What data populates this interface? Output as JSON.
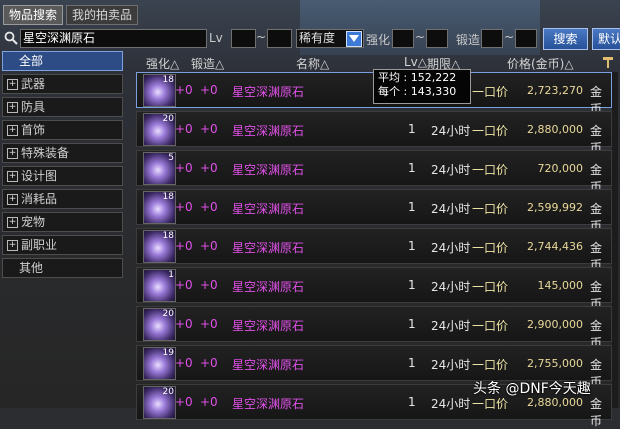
{
  "tabs": [
    {
      "label": "物品搜索",
      "active": true
    },
    {
      "label": "我的拍卖品",
      "active": false
    }
  ],
  "search": {
    "name_value": "星空深渊原石",
    "lv_label": "Lv",
    "tilde": "~",
    "rarity_value": "稀有度",
    "enhance_label": "强化",
    "forge_label": "锻造",
    "search_button": "搜索",
    "default_button": "默认"
  },
  "sidebar": {
    "items": [
      {
        "label": "全部",
        "plus": false,
        "active": true
      },
      {
        "label": "武器",
        "plus": true
      },
      {
        "label": "防具",
        "plus": true
      },
      {
        "label": "首饰",
        "plus": true
      },
      {
        "label": "特殊装备",
        "plus": true
      },
      {
        "label": "设计图",
        "plus": true
      },
      {
        "label": "消耗品",
        "plus": true
      },
      {
        "label": "宠物",
        "plus": true
      },
      {
        "label": "副职业",
        "plus": true
      },
      {
        "label": "其他",
        "plus": false
      }
    ]
  },
  "table": {
    "headers": {
      "enhance": "强化△",
      "forge": "锻造△",
      "name": "名称△",
      "lv": "Lv△",
      "period": "期限△",
      "price": "价格(金币)△"
    },
    "rows": [
      {
        "count": "18",
        "enh": "+0",
        "forge": "+0",
        "name": "星空深渊原石",
        "qty": "",
        "period": "",
        "type": "一口价",
        "price": "2,723,270",
        "unit": "金币",
        "selected": true
      },
      {
        "count": "20",
        "enh": "+0",
        "forge": "+0",
        "name": "星空深渊原石",
        "qty": "1",
        "period": "24小时",
        "type": "一口价",
        "price": "2,880,000",
        "unit": "金币"
      },
      {
        "count": "5",
        "enh": "+0",
        "forge": "+0",
        "name": "星空深渊原石",
        "qty": "1",
        "period": "24小时",
        "type": "一口价",
        "price": "720,000",
        "unit": "金币"
      },
      {
        "count": "18",
        "enh": "+0",
        "forge": "+0",
        "name": "星空深渊原石",
        "qty": "1",
        "period": "24小时",
        "type": "一口价",
        "price": "2,599,992",
        "unit": "金币"
      },
      {
        "count": "18",
        "enh": "+0",
        "forge": "+0",
        "name": "星空深渊原石",
        "qty": "1",
        "period": "24小时",
        "type": "一口价",
        "price": "2,744,436",
        "unit": "金币"
      },
      {
        "count": "1",
        "enh": "+0",
        "forge": "+0",
        "name": "星空深渊原石",
        "qty": "1",
        "period": "24小时",
        "type": "一口价",
        "price": "145,000",
        "unit": "金币"
      },
      {
        "count": "20",
        "enh": "+0",
        "forge": "+0",
        "name": "星空深渊原石",
        "qty": "1",
        "period": "24小时",
        "type": "一口价",
        "price": "2,900,000",
        "unit": "金币"
      },
      {
        "count": "19",
        "enh": "+0",
        "forge": "+0",
        "name": "星空深渊原石",
        "qty": "1",
        "period": "24小时",
        "type": "一口价",
        "price": "2,755,000",
        "unit": "金币"
      },
      {
        "count": "20",
        "enh": "+0",
        "forge": "+0",
        "name": "星空深渊原石",
        "qty": "1",
        "period": "24小时",
        "type": "一口价",
        "price": "2,880,000",
        "unit": "金币"
      }
    ]
  },
  "tooltip": {
    "avg": "平均 : 152,222",
    "each": "每个 : 143,330"
  },
  "watermark": "头条 @DNF今天趣",
  "colors": {
    "item_name": "#e050e8",
    "accent": "#3d7ad8",
    "price": "#e8d89a"
  }
}
